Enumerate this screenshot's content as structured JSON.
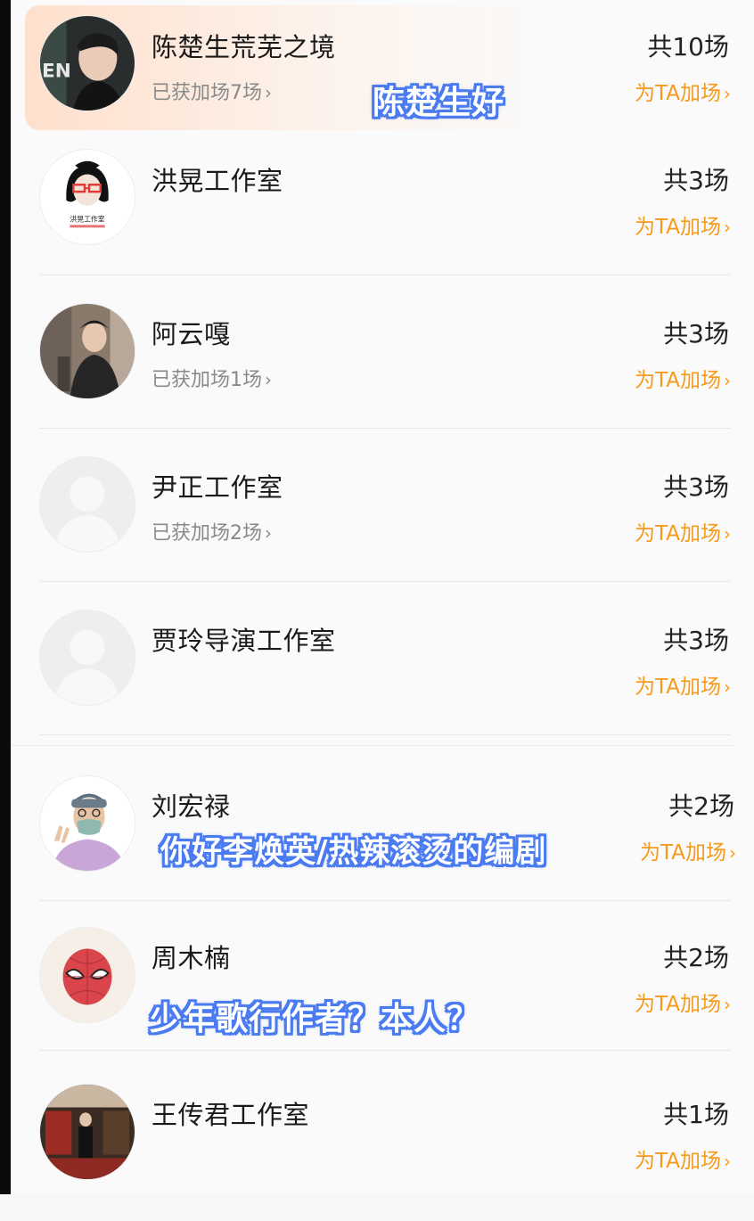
{
  "list": {
    "rows": [
      {
        "name": "陈楚生荒芜之境",
        "sub": "已获加场7场",
        "total": "共10场",
        "boost": "为TA加场",
        "avatar": "photo-man"
      },
      {
        "name": "洪晃工作室",
        "sub": "",
        "total": "共3场",
        "boost": "为TA加场",
        "avatar": "studio-logo",
        "logo_text": "洪晃工作室"
      },
      {
        "name": "阿云嘎",
        "sub": "已获加场1场",
        "total": "共3场",
        "boost": "为TA加场",
        "avatar": "photo-man-suit"
      },
      {
        "name": "尹正工作室",
        "sub": "已获加场2场",
        "total": "共3场",
        "boost": "为TA加场",
        "avatar": "default-person"
      },
      {
        "name": "贾玲导演工作室",
        "sub": "",
        "total": "共3场",
        "boost": "为TA加场",
        "avatar": "default-person"
      },
      {
        "name": "刘宏禄",
        "sub": "",
        "total": "共2场",
        "boost": "为TA加场",
        "avatar": "cartoon-mask-man"
      },
      {
        "name": "周木楠",
        "sub": "",
        "total": "共2场",
        "boost": "为TA加场",
        "avatar": "spiderman-mask"
      },
      {
        "name": "王传君工作室",
        "sub": "",
        "total": "共1场",
        "boost": "为TA加场",
        "avatar": "photo-stage"
      }
    ],
    "chevron": "›"
  },
  "overlays": {
    "caption1": "陈楚生好",
    "caption2": "你好李焕英/热辣滚烫的编剧",
    "caption3": "少年歌行作者？本人？"
  },
  "colors": {
    "accent": "#f59a1c",
    "caption_outline": "#4a7bf0"
  }
}
